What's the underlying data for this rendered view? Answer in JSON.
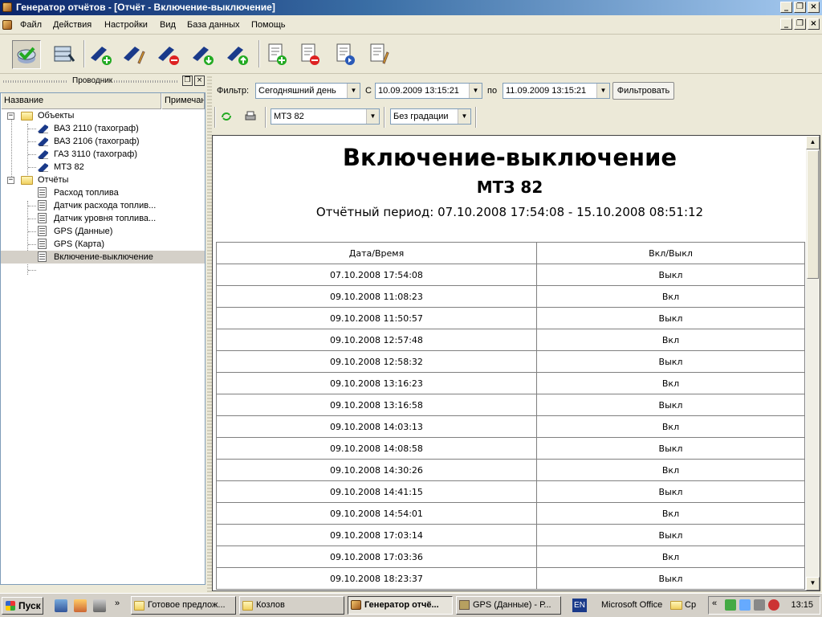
{
  "window": {
    "title": "Генератор отчётов - [Отчёт - Включение-выключение]"
  },
  "menu": [
    "Файл",
    "Действия",
    "Настройки",
    "Вид",
    "База данных",
    "Помощь"
  ],
  "toolbar": {
    "icons": [
      "check-db-icon",
      "database-icon",
      "add-object-icon",
      "edit-object-icon",
      "delete-object-icon",
      "import-object-icon",
      "export-object-icon",
      "add-report-icon",
      "delete-report-icon",
      "run-report-icon",
      "edit-report-icon"
    ]
  },
  "explorer": {
    "title": "Проводник",
    "columns": [
      "Название",
      "Примечан"
    ],
    "objects_label": "Объекты",
    "objects": [
      "ВАЗ 2110 (тахограф)",
      "ВАЗ 2106 (тахограф)",
      "ГАЗ 3110 (тахограф)",
      "МТЗ 82"
    ],
    "reports_label": "Отчёты",
    "reports": [
      "Расход топлива",
      "Датчик расхода топлив...",
      "Датчик уровня топлива...",
      "GPS (Данные)",
      "GPS (Карта)",
      "Включение-выключение"
    ]
  },
  "filter": {
    "label": "Фильтр:",
    "period": "Сегодняшний день",
    "from_label": "С",
    "from": "10.09.2009 13:15:21",
    "to_label": "по",
    "to": "11.09.2009 13:15:21",
    "apply": "Фильтровать",
    "object": "МТЗ 82",
    "gradation": "Без градации"
  },
  "report": {
    "title": "Включение-выключение",
    "object": "МТЗ 82",
    "period": "Отчётный период: 07.10.2008 17:54:08 - 15.10.2008 08:51:12",
    "headers": [
      "Дата/Время",
      "Вкл/Выкл"
    ],
    "rows": [
      [
        "07.10.2008 17:54:08",
        "Выкл"
      ],
      [
        "09.10.2008 11:08:23",
        "Вкл"
      ],
      [
        "09.10.2008 11:50:57",
        "Выкл"
      ],
      [
        "09.10.2008 12:57:48",
        "Вкл"
      ],
      [
        "09.10.2008 12:58:32",
        "Выкл"
      ],
      [
        "09.10.2008 13:16:23",
        "Вкл"
      ],
      [
        "09.10.2008 13:16:58",
        "Выкл"
      ],
      [
        "09.10.2008 14:03:13",
        "Вкл"
      ],
      [
        "09.10.2008 14:08:58",
        "Выкл"
      ],
      [
        "09.10.2008 14:30:26",
        "Вкл"
      ],
      [
        "09.10.2008 14:41:15",
        "Выкл"
      ],
      [
        "09.10.2008 14:54:01",
        "Вкл"
      ],
      [
        "09.10.2008 17:03:14",
        "Выкл"
      ],
      [
        "09.10.2008 17:03:36",
        "Вкл"
      ],
      [
        "09.10.2008 18:23:37",
        "Выкл"
      ]
    ]
  },
  "taskbar": {
    "start": "Пуск",
    "tasks": [
      "Готовое предлож...",
      "Козлов",
      "Генератор отчё...",
      "GPS (Данные) - Р...",
      "Microsoft Office",
      "Ср"
    ],
    "lang": "EN",
    "clock": "13:15"
  }
}
